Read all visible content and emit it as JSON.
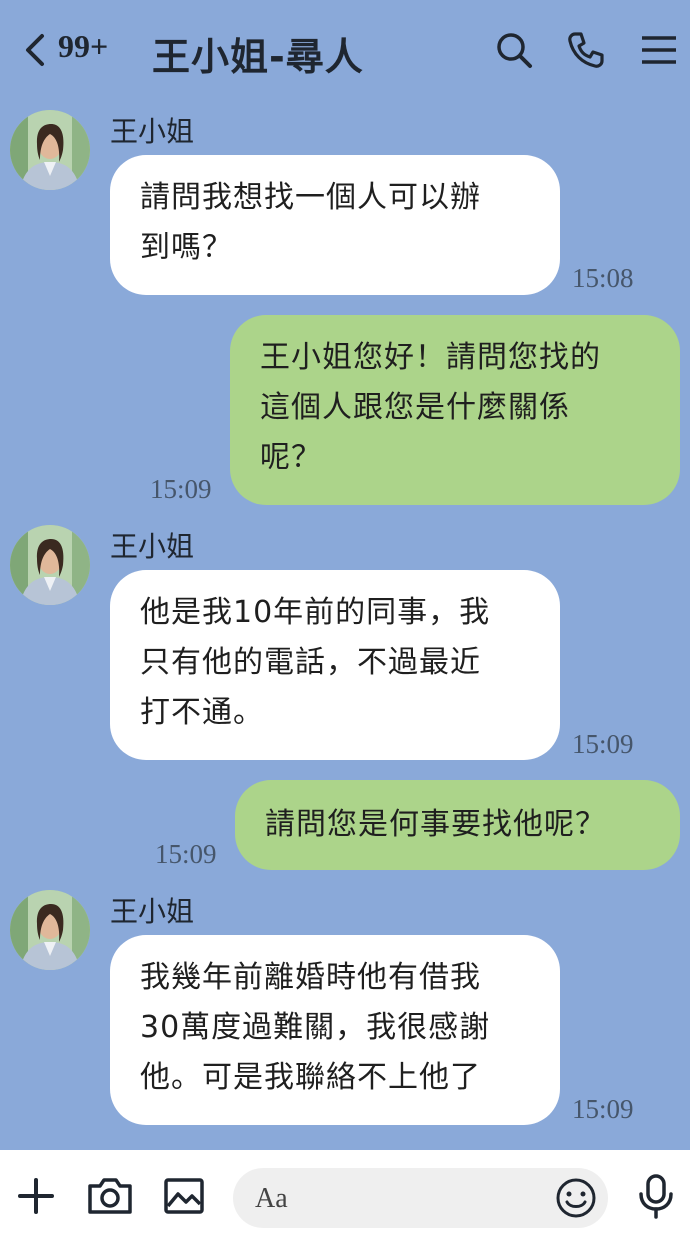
{
  "header": {
    "back_icon": "chevron-left-icon",
    "unread_count": "99+",
    "title": "王小姐-尋人",
    "icons": [
      "search-icon",
      "phone-icon",
      "menu-icon"
    ]
  },
  "messages": [
    {
      "side": "in",
      "sender": "王小姐",
      "lines": [
        "請問我想找一個人可以辦",
        "到嗎？"
      ],
      "time": "15:08"
    },
    {
      "side": "out",
      "lines": [
        "王小姐您好！請問您找的",
        "這個人跟您是什麼關係",
        "呢？"
      ],
      "time": "15:09"
    },
    {
      "side": "in",
      "sender": "王小姐",
      "lines": [
        "他是我10年前的同事，我",
        "只有他的電話，不過最近",
        "打不通。"
      ],
      "time": "15:09"
    },
    {
      "side": "out",
      "lines": [
        "請問您是何事要找他呢？"
      ],
      "time": "15:09"
    },
    {
      "side": "in",
      "sender": "王小姐",
      "lines": [
        "我幾年前離婚時他有借我",
        "30萬度過難關，我很感謝",
        "他。可是我聯絡不上他了"
      ],
      "time": "15:09"
    }
  ],
  "composer": {
    "placeholder": "Aa",
    "icons": [
      "plus-icon",
      "camera-icon",
      "image-icon",
      "emoji-icon",
      "microphone-icon"
    ]
  },
  "colors": {
    "background": "#8aa9d9",
    "incoming_bubble": "#ffffff",
    "outgoing_bubble": "#acd48a"
  }
}
